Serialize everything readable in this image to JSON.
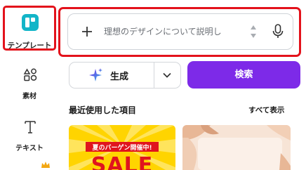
{
  "sidebar": {
    "items": [
      {
        "label": "テンプレート",
        "icon": "template-icon"
      },
      {
        "label": "素材",
        "icon": "elements-icon"
      },
      {
        "label": "テキスト",
        "icon": "text-icon"
      }
    ],
    "premium_icon": "crown-icon"
  },
  "search": {
    "placeholder": "理想のデザインについて説明し",
    "add_icon": "plus-icon",
    "stepper_icon": "up-down-arrows-icon",
    "mic_icon": "microphone-icon"
  },
  "actions": {
    "generate_label": "生成",
    "generate_icon": "sparkle-icon",
    "dropdown_icon": "chevron-down-icon",
    "search_label": "検索"
  },
  "recent": {
    "title": "最近使用した項目",
    "see_all": "すべて表示",
    "items": [
      {
        "banner_text": "夏のバーゲン開催中!",
        "headline": "SALE"
      },
      {
        "style": "floral"
      }
    ]
  },
  "colors": {
    "highlight": "#e3121b",
    "accent_purple": "#7d2ae8",
    "template_teal": "#13b5c8",
    "sale_yellow": "#ffd400",
    "sale_red": "#e0141e"
  }
}
